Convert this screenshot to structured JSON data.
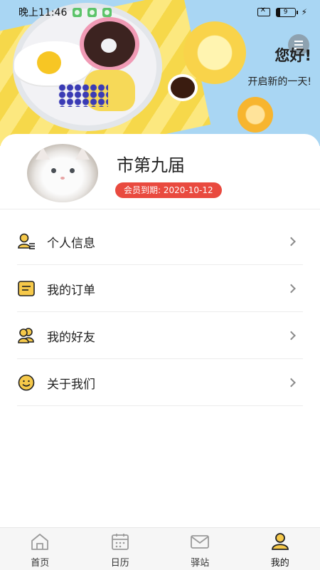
{
  "status_bar": {
    "time": "晚上11:46",
    "battery_level": "9",
    "app_notification_count": 3
  },
  "header": {
    "greeting_title": "您好!",
    "greeting_subtitle": "开启新的一天!",
    "background_color": "#a9d6f3"
  },
  "profile": {
    "username": "市第九届",
    "member_expiry_label": "会员到期: 2020-10-12",
    "badge_color": "#e94a3f"
  },
  "menu": {
    "items": [
      {
        "label": "个人信息",
        "icon": "user-info-icon"
      },
      {
        "label": "我的订单",
        "icon": "order-icon"
      },
      {
        "label": "我的好友",
        "icon": "friends-icon"
      },
      {
        "label": "关于我们",
        "icon": "smile-icon"
      }
    ]
  },
  "tabbar": {
    "tabs": [
      {
        "label": "首页",
        "icon": "home-icon",
        "active": false
      },
      {
        "label": "日历",
        "icon": "calendar-icon",
        "active": false
      },
      {
        "label": "驿站",
        "icon": "mail-icon",
        "active": false
      },
      {
        "label": "我的",
        "icon": "profile-icon",
        "active": true
      }
    ],
    "accent_color": "#f6c94a"
  }
}
